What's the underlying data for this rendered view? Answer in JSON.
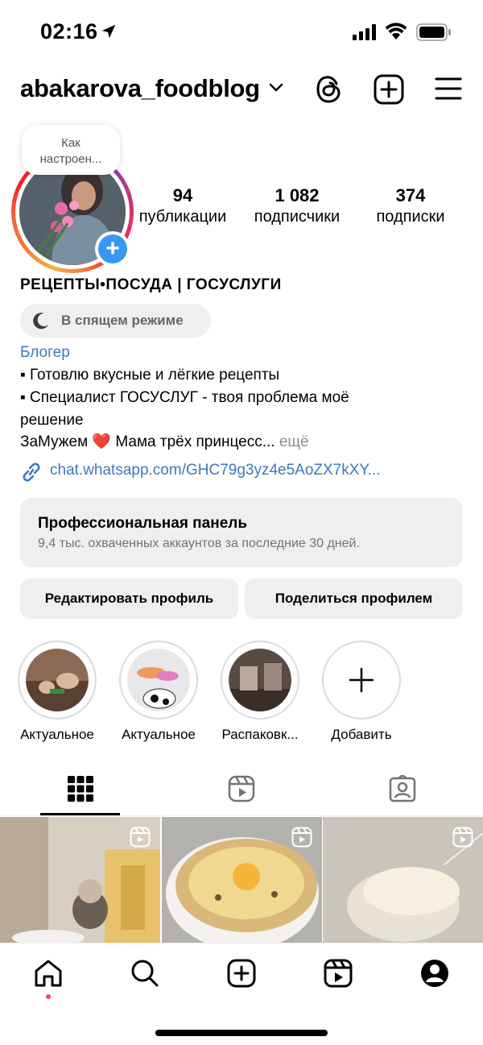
{
  "status_bar": {
    "time": "02:16"
  },
  "header": {
    "username": "abakarova_foodblog"
  },
  "profile": {
    "note": "Как настроен...",
    "stats": [
      {
        "value": "94",
        "label": "публикации"
      },
      {
        "value": "1 082",
        "label": "подписчики"
      },
      {
        "value": "374",
        "label": "подписки"
      }
    ],
    "full_name": "РЕЦЕПТЫ•ПОСУДА | ГОСУСЛУГИ",
    "sleep_label": "В спящем режиме",
    "category": "Блогер",
    "bio": {
      "line1": "▪ Готовлю вкусные и лёгкие рецепты",
      "line2": "▪ Специалист ГОСУСЛУГ - твоя проблема моё",
      "line3": "решение",
      "line4_start": "ЗаМужем ",
      "heart": "❤️",
      "line4_end": " Мама трёх принцесс...",
      "more": " ещё"
    },
    "link": "chat.whatsapp.com/GHC79g3yz4e5AoZX7kXY..."
  },
  "pro_panel": {
    "title": "Профессиональная панель",
    "subtitle": "9,4 тыс. охваченных аккаунтов за последние 30 дней."
  },
  "buttons": {
    "edit": "Редактировать профиль",
    "share": "Поделиться профилем"
  },
  "highlights": [
    {
      "label": "Актуальное"
    },
    {
      "label": "Актуальное"
    },
    {
      "label": "Распаковк..."
    },
    {
      "label": "Добавить"
    }
  ],
  "colors": {
    "accent_blue": "#3b79c1",
    "notification_red": "#ed4956",
    "panel_bg": "#efefef"
  }
}
